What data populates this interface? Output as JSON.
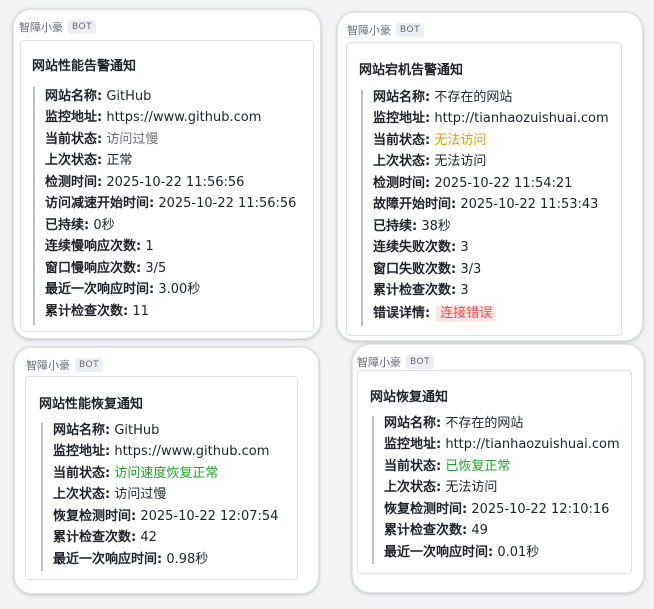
{
  "cards": [
    {
      "bot_name": "智障小豪",
      "bot_tag": "BOT",
      "title": "网站性能告警通知",
      "rows": [
        {
          "label": "网站名称:",
          "value": "GitHub"
        },
        {
          "label": "监控地址:",
          "value": "https://www.github.com"
        },
        {
          "label": "当前状态:",
          "value": "访问过慢"
        },
        {
          "label": "上次状态:",
          "value": "正常"
        },
        {
          "label": "检测时间:",
          "value": "2025-10-22 11:56:56"
        },
        {
          "label": "访问减速开始时间:",
          "value": "2025-10-22 11:56:56"
        },
        {
          "label": "已持续:",
          "value": "0秒"
        },
        {
          "label": "连续慢响应次数:",
          "value": "1"
        },
        {
          "label": "窗口慢响应次数:",
          "value": "3/5"
        },
        {
          "label": "最近一次响应时间:",
          "value": "3.00秒"
        },
        {
          "label": "累计检查次数:",
          "value": "11"
        }
      ]
    },
    {
      "bot_name": "智障小豪",
      "bot_tag": "BOT",
      "title": "网站宕机告警通知",
      "rows": [
        {
          "label": "网站名称:",
          "value": "不存在的网站"
        },
        {
          "label": "监控地址:",
          "value": "http://tianhaozuishuai.com"
        },
        {
          "label": "当前状态:",
          "value": "无法访问"
        },
        {
          "label": "上次状态:",
          "value": "无法访问"
        },
        {
          "label": "检测时间:",
          "value": "2025-10-22 11:54:21"
        },
        {
          "label": "故障开始时间:",
          "value": "2025-10-22 11:53:43"
        },
        {
          "label": "已持续:",
          "value": "38秒"
        },
        {
          "label": "连续失败次数:",
          "value": "3"
        },
        {
          "label": "窗口失败次数:",
          "value": "3/3"
        },
        {
          "label": "累计检查次数:",
          "value": "3"
        },
        {
          "label": "错误详情:",
          "value": "连接错误"
        }
      ]
    },
    {
      "bot_name": "智障小豪",
      "bot_tag": "BOT",
      "title": "网站性能恢复通知",
      "rows": [
        {
          "label": "网站名称:",
          "value": "GitHub"
        },
        {
          "label": "监控地址:",
          "value": "https://www.github.com"
        },
        {
          "label": "当前状态:",
          "value": "访问速度恢复正常"
        },
        {
          "label": "上次状态:",
          "value": "访问过慢"
        },
        {
          "label": "恢复检测时间:",
          "value": "2025-10-22 12:07:54"
        },
        {
          "label": "累计检查次数:",
          "value": "42"
        },
        {
          "label": "最近一次响应时间:",
          "value": "0.98秒"
        }
      ]
    },
    {
      "bot_name": "智障小豪",
      "bot_tag": "BOT",
      "title": "网站恢复通知",
      "rows": [
        {
          "label": "网站名称:",
          "value": "不存在的网站"
        },
        {
          "label": "监控地址:",
          "value": "http://tianhaozuishuai.com"
        },
        {
          "label": "当前状态:",
          "value": "已恢复正常"
        },
        {
          "label": "上次状态:",
          "value": "无法访问"
        },
        {
          "label": "恢复检测时间:",
          "value": "2025-10-22 12:10:16"
        },
        {
          "label": "累计检查次数:",
          "value": "49"
        },
        {
          "label": "最近一次响应时间:",
          "value": "0.01秒"
        }
      ]
    }
  ],
  "status_colors": {
    "slow": "#646a73",
    "down": "#e6a000",
    "recovered": "#1fa42a",
    "error": "#f54a45"
  }
}
